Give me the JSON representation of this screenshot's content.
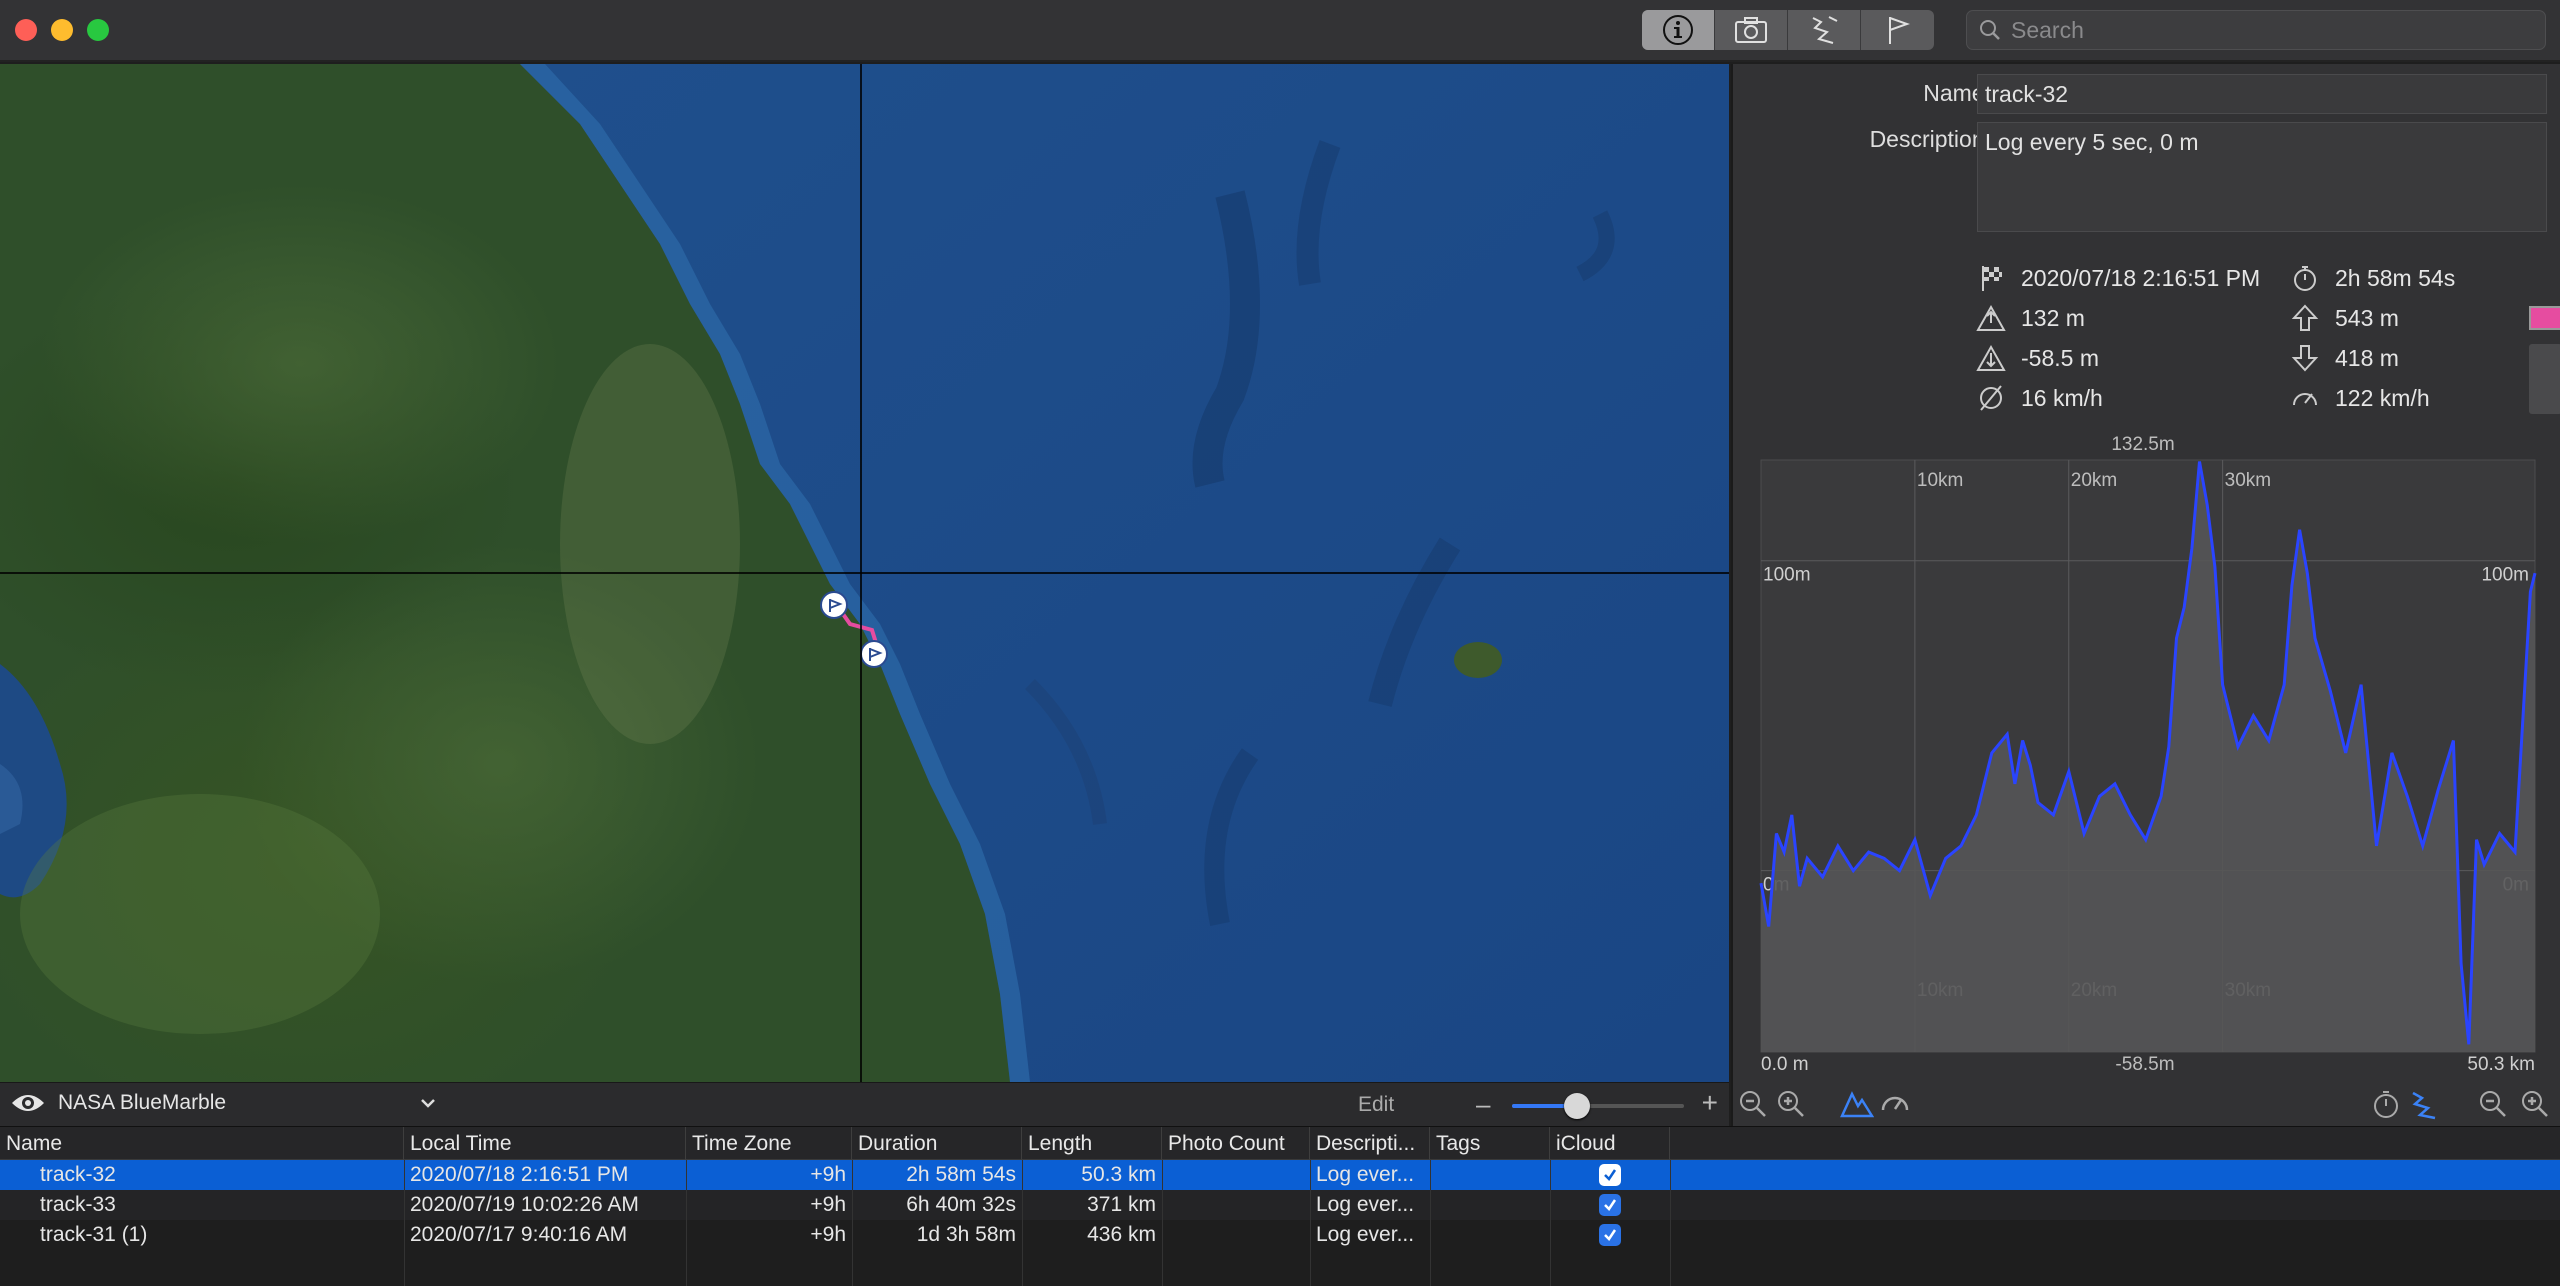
{
  "toolbar": {
    "segments": [
      {
        "icon": "info-icon",
        "active": true
      },
      {
        "icon": "camera-icon",
        "active": false
      },
      {
        "icon": "track-route-icon",
        "active": false
      },
      {
        "icon": "flag-icon",
        "active": false
      }
    ],
    "search_placeholder": "Search"
  },
  "map": {
    "layer_name": "NASA BlueMarble",
    "edit_label": "Edit",
    "zoom_level": 0.38
  },
  "inspector": {
    "name_label": "Name:",
    "name_value": "track-32",
    "description_label": "Description:",
    "description_value": "Log every 5 sec, 0 m",
    "stats": {
      "start_time": "2020/07/18 2:16:51 PM",
      "duration": "2h 58m 54s",
      "max_elevation": "132 m",
      "ascent": "543 m",
      "min_elevation": "-58.5 m",
      "descent": "418 m",
      "avg_speed": "16 km/h",
      "max_speed": "122 km/h"
    },
    "track_color": "#e64ca0"
  },
  "chart_data": {
    "type": "area",
    "xlabel": "",
    "ylabel": "",
    "x_range_km": [
      0.0,
      50.3
    ],
    "ylim": [
      -58.5,
      132.5
    ],
    "x_tick_labels_top": [
      "10km",
      "20km",
      "30km"
    ],
    "x_tick_labels_bottom": [
      "10km",
      "20km",
      "30km"
    ],
    "y_tick_labels": [
      "100m",
      "0m"
    ],
    "top_label": "132.5m",
    "bottom_left_label": "0.0 m",
    "bottom_center_label": "-58.5m",
    "bottom_right_label": "50.3 km",
    "series": [
      {
        "x": [
          0,
          0.5,
          1,
          1.5,
          2,
          2.5,
          3,
          4,
          5,
          6,
          7,
          8,
          9,
          10,
          11,
          12,
          13,
          14,
          15,
          16,
          16.5,
          17,
          17.5,
          18,
          19,
          20,
          21,
          22,
          23,
          24,
          25,
          26,
          26.5,
          27,
          27.5,
          28,
          28.5,
          29,
          29.5,
          30,
          31,
          32,
          33,
          34,
          34.5,
          35,
          35.5,
          36,
          37,
          38,
          39,
          40,
          41,
          42,
          43,
          44,
          45,
          45.5,
          46,
          46.5,
          47,
          48,
          49,
          50,
          50.3
        ],
        "values": [
          -4,
          -18,
          12,
          6,
          18,
          -5,
          4,
          -2,
          8,
          0,
          6,
          4,
          0,
          10,
          -8,
          4,
          8,
          18,
          38,
          44,
          28,
          42,
          34,
          22,
          18,
          32,
          12,
          24,
          28,
          18,
          10,
          24,
          40,
          75,
          85,
          104,
          132,
          118,
          98,
          60,
          40,
          50,
          42,
          60,
          92,
          110,
          96,
          75,
          58,
          38,
          60,
          8,
          38,
          24,
          8,
          26,
          42,
          -30,
          -56,
          10,
          2,
          12,
          6,
          90,
          96
        ]
      }
    ]
  },
  "table": {
    "columns": [
      "Name",
      "Local Time",
      "Time Zone",
      "Duration",
      "Length",
      "Photo Count",
      "Descripti...",
      "Tags",
      "iCloud"
    ],
    "rows": [
      {
        "name": "track-32",
        "local_time": "2020/07/18 2:16:51 PM",
        "time_zone": "+9h",
        "duration": "2h 58m 54s",
        "length": "50.3 km",
        "photo_count": "",
        "description": "Log ever...",
        "tags": "",
        "icloud": true,
        "selected": true
      },
      {
        "name": "track-33",
        "local_time": "2020/07/19 10:02:26 AM",
        "time_zone": "+9h",
        "duration": "6h 40m 32s",
        "length": "371 km",
        "photo_count": "",
        "description": "Log ever...",
        "tags": "",
        "icloud": true,
        "selected": false
      },
      {
        "name": "track-31 (1)",
        "local_time": "2020/07/17 9:40:16 AM",
        "time_zone": "+9h",
        "duration": "1d 3h 58m",
        "length": "436 km",
        "photo_count": "",
        "description": "Log ever...",
        "tags": "",
        "icloud": true,
        "selected": false
      }
    ]
  }
}
